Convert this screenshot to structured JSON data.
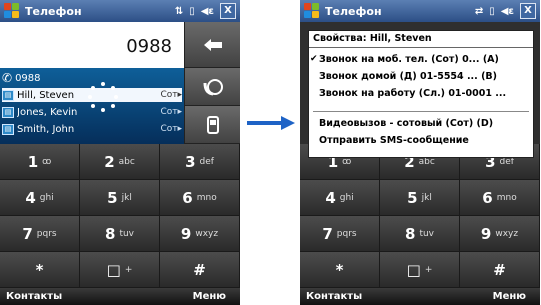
{
  "left_screen": {
    "title": "Телефон",
    "status_icons": [
      "signal-icon",
      "battery-icon",
      "volume-icon"
    ],
    "close_label": "X",
    "dialed_number": "0988",
    "matches": [
      {
        "name": "0988",
        "tag": ""
      },
      {
        "name": "Hill, Steven",
        "tag": "Сот▸"
      },
      {
        "name": "Jones, Kevin",
        "tag": "Сот▸"
      },
      {
        "name": "Smith, John",
        "tag": "Сот▸"
      }
    ],
    "keys": [
      {
        "digit": "1",
        "letters": "ꝏ"
      },
      {
        "digit": "2",
        "letters": "abc"
      },
      {
        "digit": "3",
        "letters": "def"
      },
      {
        "digit": "4",
        "letters": "ghi"
      },
      {
        "digit": "5",
        "letters": "jkl"
      },
      {
        "digit": "6",
        "letters": "mno"
      },
      {
        "digit": "7",
        "letters": "pqrs"
      },
      {
        "digit": "8",
        "letters": "tuv"
      },
      {
        "digit": "9",
        "letters": "wxyz"
      },
      {
        "digit": "*",
        "letters": ""
      },
      {
        "digit": "0",
        "letters": "+"
      },
      {
        "digit": "#",
        "letters": ""
      }
    ],
    "soft_left": "Контакты",
    "soft_right": "Меню"
  },
  "right_screen": {
    "title": "Телефон",
    "close_label": "X",
    "menu_header": "Свойства: Hill, Steven",
    "menu_items": [
      {
        "label": "Звонок на моб. тел. (Сот) 0... (A)",
        "checked": true
      },
      {
        "label": "Звонок домой (Д) 01-5554 ... (B)",
        "checked": false
      },
      {
        "label": "Звонок на работу (Сл.) 01-0001 ...",
        "checked": false
      },
      {
        "label": "Видеовызов - сотовый (Сот) (D)",
        "checked": false
      },
      {
        "label": "Отправить SMS-сообщение",
        "checked": false
      }
    ],
    "keys_visible": [
      {
        "digit": "1",
        "letters": "ꝏ"
      },
      {
        "digit": "2",
        "letters": "abc"
      },
      {
        "digit": "3",
        "letters": "def"
      },
      {
        "digit": "4",
        "letters": "ghi"
      },
      {
        "digit": "5",
        "letters": "jkl"
      },
      {
        "digit": "6",
        "letters": "mno"
      },
      {
        "digit": "7",
        "letters": "pqrs"
      },
      {
        "digit": "8",
        "letters": "tuv"
      },
      {
        "digit": "9",
        "letters": "wxyz"
      },
      {
        "digit": "*",
        "letters": ""
      },
      {
        "digit": "0",
        "letters": "+"
      },
      {
        "digit": "#",
        "letters": ""
      }
    ],
    "soft_left": "Контакты",
    "soft_right": "Меню"
  },
  "arrow_color": "#1e63c6",
  "accent_color": "#0e5f99"
}
